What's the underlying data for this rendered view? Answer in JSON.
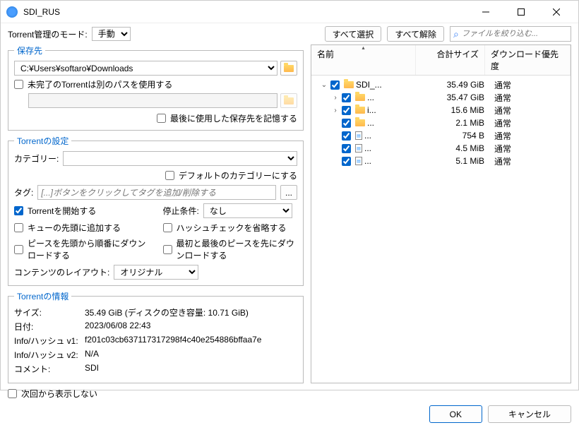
{
  "window": {
    "title": "SDI_RUS"
  },
  "mode": {
    "label": "Torrent管理のモード:",
    "value": "手動"
  },
  "topButtons": {
    "selectAll": "すべて選択",
    "deselectAll": "すべて解除"
  },
  "search": {
    "placeholder": "ファイルを絞り込む..."
  },
  "saveDest": {
    "legend": "保存先",
    "path": "C:¥Users¥softaro¥Downloads",
    "incompletePath": "未完了のTorrentは別のパスを使用する",
    "remember": "最後に使用した保存先を記憶する"
  },
  "settings": {
    "legend": "Torrentの設定",
    "category": {
      "label": "カテゴリー:",
      "value": ""
    },
    "defaultCategory": "デフォルトのカテゴリーにする",
    "tag": {
      "label": "タグ:",
      "placeholder": "[...]ボタンをクリックしてタグを追加/削除する"
    },
    "startTorrent": "Torrentを開始する",
    "stopCondition": {
      "label": "停止条件:",
      "value": "なし"
    },
    "addToTop": "キューの先頭に追加する",
    "skipHash": "ハッシュチェックを省略する",
    "sequential": "ピースを先頭から順番にダウンロードする",
    "firstLast": "最初と最後のピースを先にダウンロードする",
    "layout": {
      "label": "コンテンツのレイアウト:",
      "value": "オリジナル"
    }
  },
  "info": {
    "legend": "Torrentの情報",
    "size": {
      "label": "サイズ:",
      "value": "35.49 GiB (ディスクの空き容量: 10.71 GiB)"
    },
    "date": {
      "label": "日付:",
      "value": "2023/06/08 22:43"
    },
    "hashV1": {
      "label": "Info/ハッシュ v1:",
      "value": "f201c03cb637117317298f4c40e254886bffaa7e"
    },
    "hashV2": {
      "label": "Info/ハッシュ v2:",
      "value": "N/A"
    },
    "comment": {
      "label": "コメント:",
      "value": "SDI"
    }
  },
  "dontShow": "次回から表示しない",
  "buttons": {
    "ok": "OK",
    "cancel": "キャンセル"
  },
  "tree": {
    "headers": {
      "name": "名前",
      "size": "合計サイズ",
      "priority": "ダウンロード優先度"
    },
    "rows": [
      {
        "indent": 0,
        "expand": "v",
        "icon": "folder",
        "name": "SDI_...",
        "size": "35.49 GiB",
        "priority": "通常"
      },
      {
        "indent": 1,
        "expand": ">",
        "icon": "folder",
        "name": "...",
        "size": "35.47 GiB",
        "priority": "通常"
      },
      {
        "indent": 1,
        "expand": ">",
        "icon": "folder",
        "name": "i...",
        "size": "15.6 MiB",
        "priority": "通常"
      },
      {
        "indent": 1,
        "expand": "",
        "icon": "folder",
        "name": "...",
        "size": "2.1 MiB",
        "priority": "通常"
      },
      {
        "indent": 1,
        "expand": "",
        "icon": "file",
        "name": "...",
        "size": "754 B",
        "priority": "通常"
      },
      {
        "indent": 1,
        "expand": "",
        "icon": "file",
        "name": "...",
        "size": "4.5 MiB",
        "priority": "通常"
      },
      {
        "indent": 1,
        "expand": "",
        "icon": "file",
        "name": "...",
        "size": "5.1 MiB",
        "priority": "通常"
      }
    ]
  }
}
